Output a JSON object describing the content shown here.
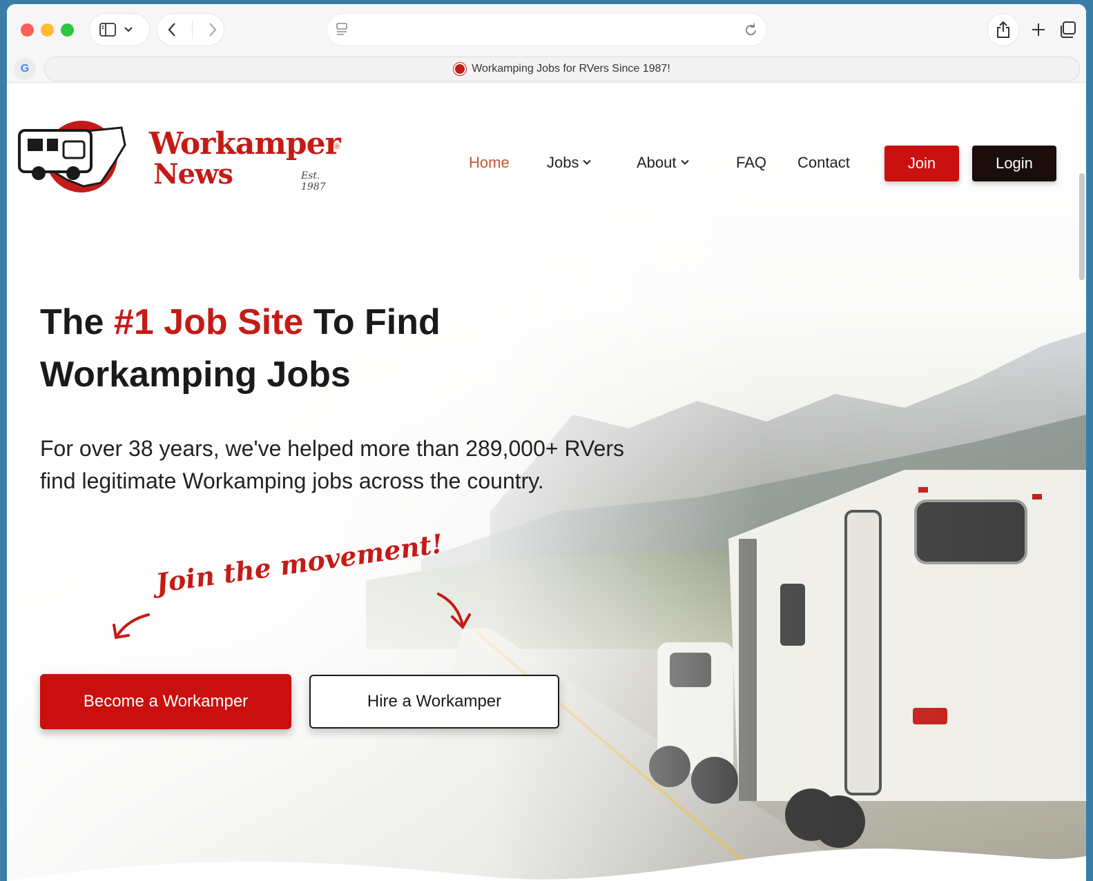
{
  "browser": {
    "tab_title": "Workamping Jobs for RVers Since 1987!",
    "address_text": "",
    "google_button": "G"
  },
  "icons": {
    "sidebar": "sidebar-icon",
    "back": "chevron-left-icon",
    "forward": "chevron-right-icon",
    "reload": "reload-icon",
    "share": "share-icon",
    "new_tab": "plus-icon",
    "tabs": "tabs-icon"
  },
  "brand": {
    "name_line1": "Workamper",
    "name_line2": "News",
    "registered": "®",
    "established": "Est. 1987",
    "primary_color": "#c41b16",
    "dark_color": "#1a0d0b"
  },
  "nav": {
    "home": "Home",
    "jobs": "Jobs",
    "about": "About",
    "faq": "FAQ",
    "contact": "Contact",
    "join": "Join",
    "login": "Login"
  },
  "hero": {
    "title_pre": "The ",
    "title_highlight": "#1 Job Site",
    "title_post": " To Find",
    "title_line2": "Workamping Jobs",
    "subtitle": "For over 38 years, we've helped more than 289,000+ RVers find legitimate Workamping jobs across the country.",
    "callout": "Join the movement!",
    "cta_primary": "Become a Workamper",
    "cta_secondary": "Hire a Workamper"
  }
}
